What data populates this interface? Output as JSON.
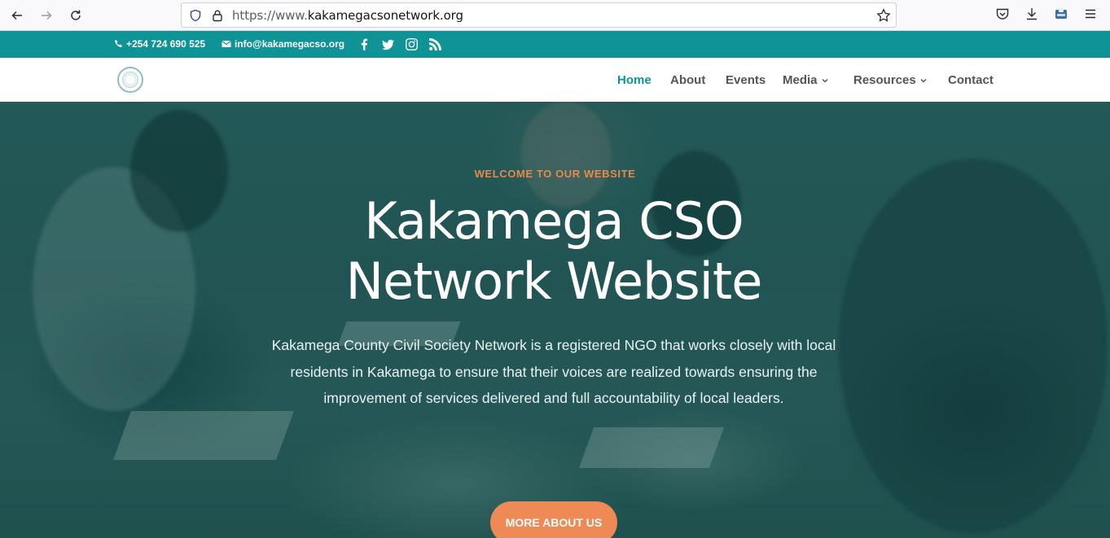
{
  "browser": {
    "url_prefix": "https://www.",
    "url_domain": "kakamegacsonetwork.org"
  },
  "topbar": {
    "phone": "+254 724 690 525",
    "email": "info@kakamegacso.org",
    "social": [
      "facebook-icon",
      "twitter-icon",
      "instagram-icon",
      "rss-icon"
    ]
  },
  "nav": {
    "items": [
      {
        "label": "Home",
        "active": true
      },
      {
        "label": "About"
      },
      {
        "label": "Events"
      },
      {
        "label": "Media",
        "dropdown": true
      },
      {
        "label": "Resources",
        "dropdown": true
      },
      {
        "label": "Contact"
      }
    ]
  },
  "hero": {
    "kicker": "WELCOME TO OUR WEBSITE",
    "title_line1": "Kakamega CSO",
    "title_line2": "Network Website",
    "text": "Kakamega County Civil Society Network is a registered NGO that works closely with local residents in Kakamega to ensure that their voices are realized towards ensuring the improvement of services delivered and full accountability of local leaders.",
    "cta": "MORE ABOUT US"
  },
  "colors": {
    "brand_teal": "#109396",
    "accent_orange": "#ee8a55",
    "kicker_orange": "#e5894d"
  }
}
